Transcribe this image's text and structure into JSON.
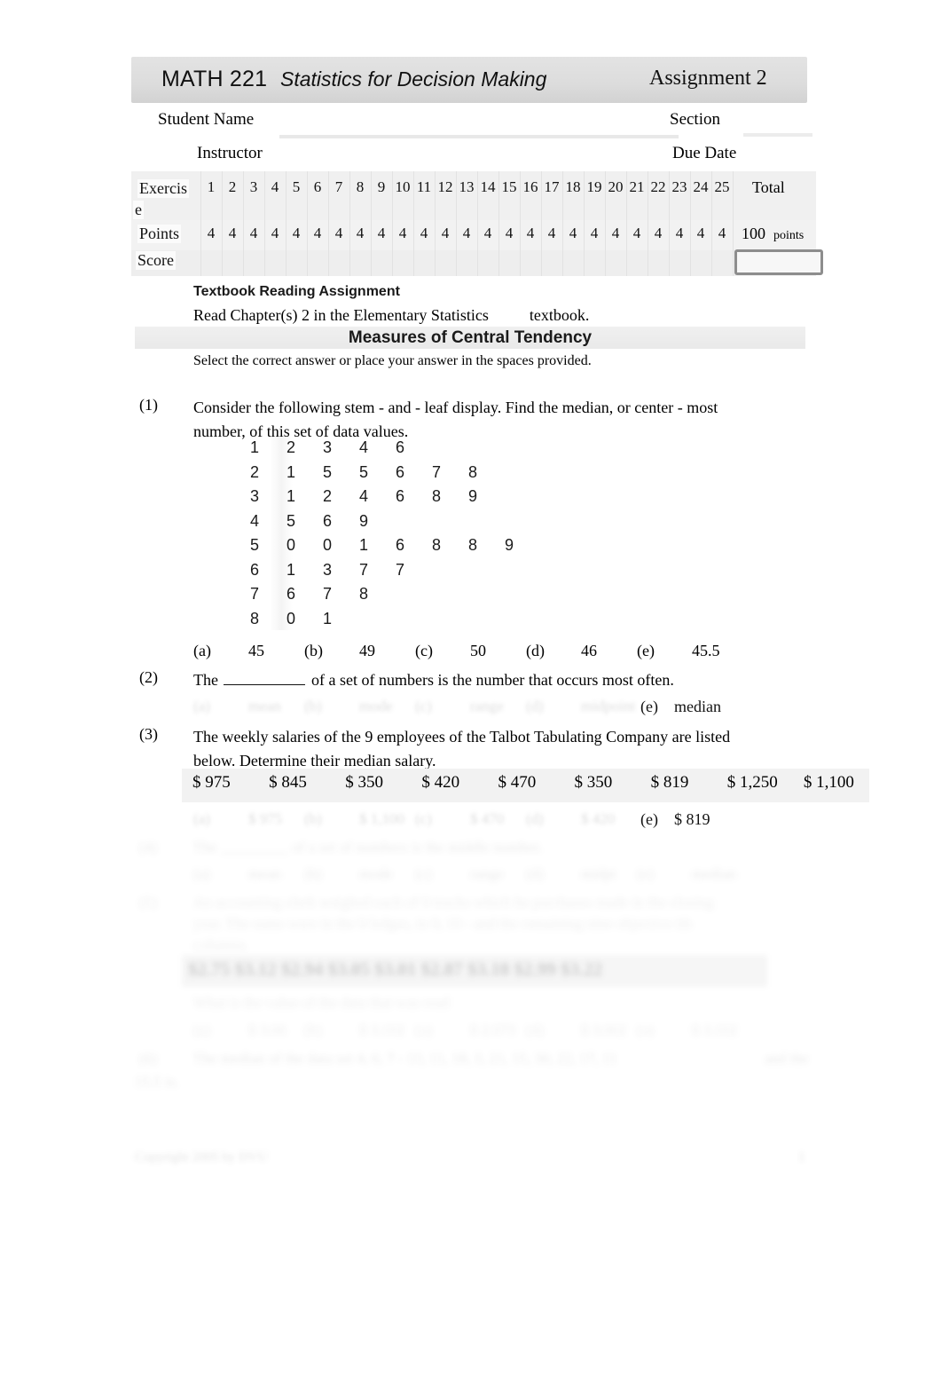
{
  "header": {
    "course_code": "MATH 221",
    "course_title": "Statistics for Decision Making",
    "assignment": "Assignment 2"
  },
  "fields": {
    "student_name_label": "Student Name",
    "section_label": "Section",
    "instructor_label": "Instructor",
    "due_date_label": "Due Date",
    "student_name_value": "",
    "section_value": "",
    "instructor_value": "",
    "due_date_value": ""
  },
  "score_table": {
    "exercise_label_line1": "Exercis",
    "exercise_label_line2": "e",
    "points_label": "Points",
    "score_label": "Score",
    "total_label": "Total",
    "exercise_numbers": [
      "1",
      "2",
      "3",
      "4",
      "5",
      "6",
      "7",
      "8",
      "9",
      "10",
      "11",
      "12",
      "13",
      "14",
      "15",
      "16",
      "17",
      "18",
      "19",
      "20",
      "21",
      "22",
      "23",
      "24",
      "25"
    ],
    "points_values": [
      "4",
      "4",
      "4",
      "4",
      "4",
      "4",
      "4",
      "4",
      "4",
      "4",
      "4",
      "4",
      "4",
      "4",
      "4",
      "4",
      "4",
      "4",
      "4",
      "4",
      "4",
      "4",
      "4",
      "4",
      "4"
    ],
    "total_points": "100",
    "total_points_unit": "points",
    "score_value": ""
  },
  "textbook": {
    "heading": "Textbook Reading Assignment",
    "line_part1": "Read Chapter(s) 2 in the Elementary Statistics",
    "line_part2": "textbook."
  },
  "section": {
    "title": "Measures of Central Tendency",
    "instruction": "Select the correct answer or place your answer in the spaces provided."
  },
  "questions": [
    {
      "number": "(1)",
      "text_line1": "Consider the following stem - and - leaf display.  Find the median, or center - most",
      "text_line2": "number, of this set of data values.",
      "stem_leaf": [
        {
          "stem": "1",
          "leaves": [
            "2",
            "3",
            "4",
            "6"
          ]
        },
        {
          "stem": "2",
          "leaves": [
            "1",
            "5",
            "5",
            "6",
            "7",
            "8"
          ]
        },
        {
          "stem": "3",
          "leaves": [
            "1",
            "2",
            "4",
            "6",
            "8",
            "9"
          ]
        },
        {
          "stem": "4",
          "leaves": [
            "5",
            "6",
            "9"
          ]
        },
        {
          "stem": "5",
          "leaves": [
            "0",
            "0",
            "1",
            "6",
            "8",
            "8",
            "9"
          ]
        },
        {
          "stem": "6",
          "leaves": [
            "1",
            "3",
            "7",
            "7"
          ]
        },
        {
          "stem": "7",
          "leaves": [
            "6",
            "7",
            "8"
          ]
        },
        {
          "stem": "8",
          "leaves": [
            "0",
            "1"
          ]
        }
      ],
      "choices": [
        {
          "letter": "(a)",
          "value": "45"
        },
        {
          "letter": "(b)",
          "value": "49"
        },
        {
          "letter": "(c)",
          "value": "50"
        },
        {
          "letter": "(d)",
          "value": "46"
        },
        {
          "letter": "(e)",
          "value": "45.5"
        }
      ]
    },
    {
      "number": "(2)",
      "text_before_blank": "The",
      "text_after_blank": "of a set of numbers is the number that occurs most often.",
      "choices_faded": [
        {
          "letter": "(a)",
          "value": "mean"
        },
        {
          "letter": "(b)",
          "value": "mode"
        },
        {
          "letter": "(c)",
          "value": "range"
        },
        {
          "letter": "(d)",
          "value": "midpoint"
        }
      ],
      "choice_visible": {
        "letter": "(e)",
        "value": "median"
      }
    },
    {
      "number": "(3)",
      "text_line1": "The weekly salaries of the 9 employees of the Talbot Tabulating Company are listed",
      "text_line2": "below.  Determine their median salary.",
      "salaries": [
        "$ 975",
        "$ 845",
        "$ 350",
        "$ 420",
        "$ 470",
        "$ 350",
        "$ 819",
        "$ 1,250",
        "$ 1,100"
      ],
      "choices_faded": [
        {
          "letter": "(a)",
          "value": "$ 975"
        },
        {
          "letter": "(b)",
          "value": "$ 1,100"
        },
        {
          "letter": "(c)",
          "value": "$ 470"
        },
        {
          "letter": "(d)",
          "value": "$ 420"
        }
      ],
      "choice_visible": {
        "letter": "(e)",
        "value": "$ 819"
      }
    },
    {
      "number": "(4)",
      "faded": true,
      "text_line1": "The _________ of a set of numbers is the middle number.",
      "choices_faded": [
        {
          "letter": "(a)",
          "value": "mean"
        },
        {
          "letter": "(b)",
          "value": "mode"
        },
        {
          "letter": "(c)",
          "value": "range"
        },
        {
          "letter": "(d)",
          "value": "midpt"
        },
        {
          "letter": "(e)",
          "value": "median"
        }
      ]
    },
    {
      "number": "(5)",
      "faded": true,
      "text_line1": "An accounting clerk weighed each of 9 trucks which he purchases made in the closing",
      "text_line2": "year.  The sums were in the 9 ledges, in 9, 10 - and the remaining nine objective ith",
      "text_line3": "columns.",
      "data_row": "$2.75   $3.12   $2.94   $3.05   $3.01   $2.87   $3.18   $2.99   $3.22",
      "question_line": "What is the value of the data that was read",
      "choices_faded": [
        {
          "letter": "(a)",
          "value": "$ 3.06"
        },
        {
          "letter": "(b)",
          "value": "$ 3.102"
        },
        {
          "letter": "(c)",
          "value": "$ 2.973"
        },
        {
          "letter": "(d)",
          "value": "$ 3.002"
        },
        {
          "letter": "(e)",
          "value": "$ 3.102"
        }
      ]
    },
    {
      "number": "(6)",
      "faded": true,
      "text_line1": "The median of the data set 4, 6, 7 - 13, 11, 18, 3, 21, 15, 30, 22, 17, 11",
      "text_trailing": "and the",
      "text_line2": "15.5 is."
    }
  ],
  "footer": {
    "left": "Copyright 2005 by DVU",
    "right": "1"
  },
  "colors": {
    "banner_gray": "#dcdcdc",
    "table_band": "#f0f0f0",
    "score_box_border": "#8d8d8d",
    "text": "#111111"
  }
}
